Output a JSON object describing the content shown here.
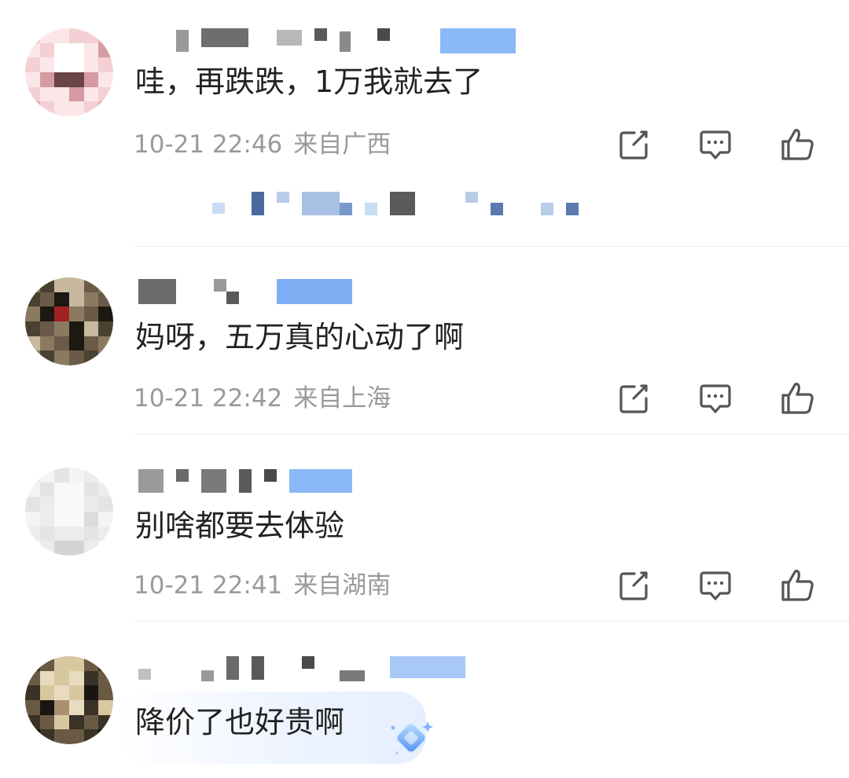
{
  "comments": [
    {
      "text": "哇，再跌跌，1万我就去了",
      "time": "10-21 22:46",
      "location": "来自广西",
      "avatar_colors": [
        "#f4d0d4",
        "#e8b0b8",
        "#fbe6e8",
        "#6a4448",
        "#d69aa2",
        "#ffffff"
      ]
    },
    {
      "text": "妈呀，五万真的心动了啊",
      "time": "10-21 22:42",
      "location": "来自上海",
      "avatar_colors": [
        "#4a4230",
        "#8b7a60",
        "#1c1812",
        "#a02222",
        "#c8b8a0",
        "#6a5a48"
      ]
    },
    {
      "text": "别啥都要去体验",
      "time": "10-21 22:41",
      "location": "来自湖南",
      "avatar_colors": [
        "#ececec",
        "#f4f4f4",
        "#dcdcdc",
        "#e4e4e4",
        "#f8f8f8",
        "#d4d4d4"
      ]
    },
    {
      "text": "降价了也好贵啊",
      "avatar_colors": [
        "#3a3226",
        "#d8c8a0",
        "#1a1510",
        "#a89070",
        "#e8dcc0",
        "#6a5a44"
      ]
    }
  ],
  "icons": {
    "share": "share-icon",
    "reply": "comment-icon",
    "like": "thumbs-up-icon"
  },
  "colors": {
    "name_mosaic": "#7a7a7a",
    "badge_mosaic": "#7fb0f5",
    "sub_mosaic": "#5a7ab0",
    "text": "#222222",
    "meta": "#9a9a9a",
    "icon": "#555555"
  }
}
